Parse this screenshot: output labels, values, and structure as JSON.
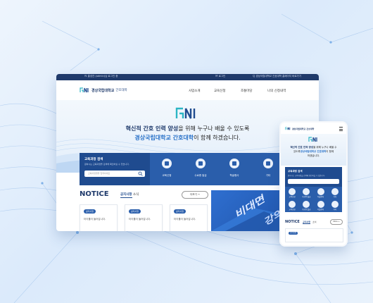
{
  "desktop": {
    "topbar": {
      "left": "Ｎ 홍성건 (admin)님 로그인 중",
      "middle": "Ｍ 로그인",
      "right": "Ｑ 경상국립대학교 간호대학 홈페이지 바로가기"
    },
    "logo": {
      "name": "경상국립대학교",
      "sub": "간호대학"
    },
    "nav": [
      "사업소개",
      "교육신청",
      "조통마당",
      "나의 신청내역"
    ],
    "hero": {
      "line1_bold": "혁신적 간호 인력 양성",
      "line1_rest": "을 위해 누구나 배울 수 있도록",
      "line2_bold": "경상국립대학교 간호대학",
      "line2_rest": "이 함께 하겠습니다."
    },
    "search": {
      "title": "교육과정 검색",
      "desc": "원하시는 교육과정을 검색해 확인하실 수 있습니다.",
      "placeholder": "교육과정명을 입력하세요"
    },
    "quick": [
      "교육신청",
      "수료증 발급",
      "학술행사",
      "기타"
    ],
    "notice": {
      "title": "NOTICE",
      "tab_active": "공지사항",
      "tab_other": "소식",
      "more": "더보기 →",
      "cards": [
        {
          "badge": "공지사항",
          "text": "타이틀이 들어갑니다."
        },
        {
          "badge": "공지사항",
          "text": "타이틀이 들어갑니다."
        },
        {
          "badge": "공지사항",
          "text": "타이틀이 들어갑니다."
        }
      ]
    },
    "banner": {
      "word1": "비대면",
      "word2": "강의안내"
    }
  },
  "mobile": {
    "logo": "경상국립대학교 간호대학",
    "hero": {
      "a_bold": "혁신적 간호 인력 양성",
      "a_rest": "을 위해 누구나 배울 수",
      "b_pre": "있도록",
      "b_bold": "경상국립대학교 간호대학",
      "b_rest": "이 함께",
      "c": "하겠습니다."
    },
    "search": {
      "title": "교육과정 검색",
      "desc": "원하시는 교육과정을 검색해 확인하실 수 있습니다."
    },
    "quick": [
      "교육신청",
      "수료증 발급",
      "학술행사",
      "기타",
      "교육신청",
      "수료증 발급",
      "학술행사",
      "기타"
    ],
    "notice": {
      "title": "NOTICE",
      "tab_active": "공지사항",
      "tab_other": "소식",
      "more": "More +",
      "badge": "공지사항"
    }
  },
  "colors": {
    "navy": "#1f3a6b",
    "blue": "#2a5eab",
    "accent": "#2b73c9"
  }
}
